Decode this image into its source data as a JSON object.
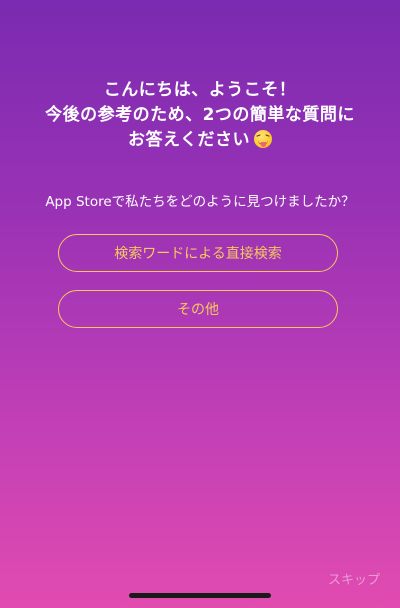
{
  "headline": {
    "line1": "こんにちは、ようこそ！",
    "line2": "今後の参考のため、2つの簡単な質問に",
    "line3": "お答えください",
    "emoji_icon": "squinting-face-with-tongue-icon"
  },
  "question": "App Storeで私たちをどのように見つけましたか？",
  "options": [
    {
      "label": "検索ワードによる直接検索"
    },
    {
      "label": "その他"
    }
  ],
  "skip_label": "スキップ",
  "colors": {
    "gradient_top": "#7a2bb1",
    "gradient_bottom": "#e14bb0",
    "accent": "#f6c85c",
    "text": "#ffffff"
  }
}
